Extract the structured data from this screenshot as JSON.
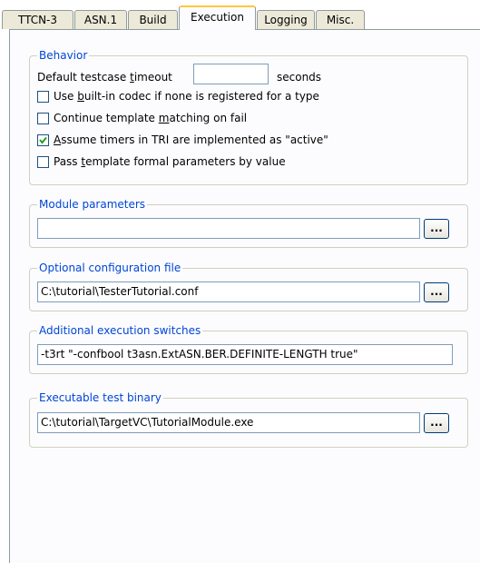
{
  "tabs": [
    {
      "label": "TTCN-3",
      "active": false
    },
    {
      "label": "ASN.1",
      "active": false
    },
    {
      "label": "Build",
      "active": false
    },
    {
      "label": "Execution",
      "active": true
    },
    {
      "label": "Logging",
      "active": false
    },
    {
      "label": "Misc.",
      "active": false
    }
  ],
  "behavior": {
    "legend": "Behavior",
    "timeout_label_pre": "Default testcase ",
    "timeout_label_key": "t",
    "timeout_label_post": "imeout",
    "timeout_value": "",
    "timeout_unit": "seconds",
    "options": [
      {
        "pre": "Use ",
        "key": "b",
        "post": "uilt-in codec if none is registered for a type",
        "checked": false
      },
      {
        "pre": "Continue template ",
        "key": "m",
        "post": "atching on fail",
        "checked": false
      },
      {
        "pre": "",
        "key": "A",
        "post": "ssume timers in TRI are implemented as \"active\"",
        "checked": true
      },
      {
        "pre": "Pass ",
        "key": "t",
        "post": "emplate formal parameters by value",
        "checked": false
      }
    ]
  },
  "module_parameters": {
    "legend": "Module parameters",
    "value": "",
    "browse_label": "..."
  },
  "config_file": {
    "legend": "Optional configuration file",
    "value": "C:\\tutorial\\TesterTutorial.conf",
    "browse_label": "..."
  },
  "exec_switches": {
    "legend": "Additional execution switches",
    "value": "-t3rt \"-confbool t3asn.ExtASN.BER.DEFINITE-LENGTH true\""
  },
  "test_binary": {
    "legend": "Executable test binary",
    "value": "C:\\tutorial\\TargetVC\\TutorialModule.exe",
    "browse_label": "..."
  },
  "colors": {
    "accent": "#0046d5",
    "tab_highlight": "#ffc83c",
    "check": "#21a121"
  }
}
